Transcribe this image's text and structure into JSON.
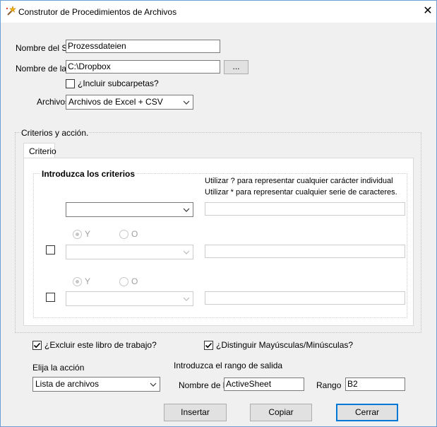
{
  "window": {
    "title": "Construtor de Procedimientos de Archivos",
    "close_glyph": "✕"
  },
  "form": {
    "nombre_sub_label": "Nombre del Su",
    "nombre_sub_value": "Prozessdateien",
    "nombre_carpeta_label": "Nombre de la c",
    "nombre_carpeta_value": "C:\\Dropbox",
    "browse_label": "...",
    "incluir_label": "¿Incluir subcarpetas?",
    "incluir_checked": false,
    "archivos_label": "Archivos",
    "archivos_value": "Archivos de Excel + CSV"
  },
  "criteria": {
    "group_label": "Criterios y acción.",
    "tab_label": "Criterio",
    "heading": "Introduzca los criterios",
    "hint1": "Utilizar ? para representar cualquier carácter individual",
    "hint2": "Utilizar * para representar cualquier serie de caracteres.",
    "row1": {
      "combo_value": "",
      "text_value": ""
    },
    "row2": {
      "checked": false,
      "radio_y": "Y",
      "radio_o": "O",
      "y_selected": true,
      "combo_value": "",
      "text_value": ""
    },
    "row3": {
      "checked": false,
      "radio_y": "Y",
      "radio_o": "O",
      "y_selected": true,
      "combo_value": "",
      "text_value": ""
    }
  },
  "options": {
    "excluir_label": "¿Excluir este libro de trabajo?",
    "excluir_checked": true,
    "distinguir_label": "¿Distinguir Mayúsculas/Minúsculas?",
    "distinguir_checked": true
  },
  "action": {
    "elija_label": "Elija la acción",
    "action_value": "Lista de archivos",
    "rango_heading": "Introduzca el rango de salida",
    "nombre_label": "Nombre de la",
    "nombre_value": "ActiveSheet",
    "rango_label": "Rango",
    "rango_value": "B2"
  },
  "buttons": {
    "insertar": "Insertar",
    "copiar": "Copiar",
    "cerrar": "Cerrar"
  },
  "colors": {
    "accent": "#0078d7",
    "window_bg": "#f0f0f0",
    "disabled": "#a0a0a0"
  }
}
